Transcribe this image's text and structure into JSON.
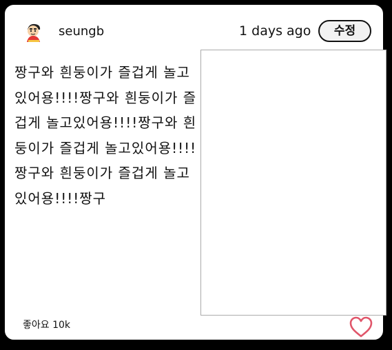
{
  "post": {
    "username": "seungb",
    "timestamp": "1 days ago",
    "edit_label": "수정",
    "content": "짱구와 흰둥이가 즐겁게 놀고있어용!!!!짱구와 흰둥이가 즐겁게 놀고있어용!!!!짱구와 흰둥이가 즐겁게 놀고있어용!!!!짱구와 흰둥이가 즐겁게 놀고있어용!!!!짱구",
    "likes_text": "좋아요 10k"
  },
  "icons": {
    "avatar": "shin-chan-avatar-icon",
    "like": "heart-outline-icon"
  },
  "colors": {
    "heart": "#e0566a",
    "border": "#000000"
  }
}
